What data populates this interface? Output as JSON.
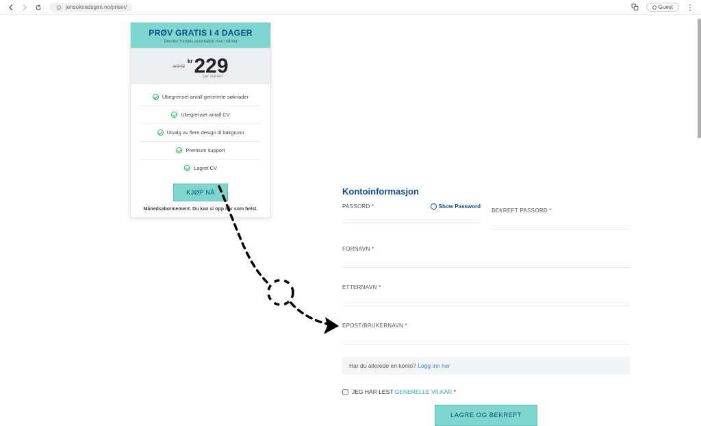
{
  "browser": {
    "url": "jensoknadsgen.no/priser/",
    "profile_label": "Guest"
  },
  "card": {
    "title": "PRØV GRATIS I 4 DAGER",
    "subtitle": "Deretter fornyes automatisk hver måned",
    "strike_price": "kr349",
    "currency": "kr",
    "price": "229",
    "per": "per måned",
    "features": [
      "Ubegrenset antall genererte søknader",
      "Ubegrenset antall CV",
      "Utvalg av flere design til bakgrunn",
      "Premium support",
      "Lagret CV"
    ],
    "buy_label": "KJØP NÅ",
    "footnote": "Månedsabonnement. Du kan si opp når som helst."
  },
  "form": {
    "title": "Kontoinformasjon",
    "password_label": "PASSORD *",
    "show_password": "Show Password",
    "confirm_label": "BEKREFT PASSORD *",
    "firstname_label": "FORNAVN *",
    "lastname_label": "ETTERNAVN *",
    "email_label": "EPOST/BRUKERNAVN *",
    "already_text": "Har du allerede en konto? ",
    "login_link": "Logg inn her",
    "terms_prefix": "JEG HAR LEST ",
    "terms_link": "GENERELLE VILKÅR",
    "terms_suffix": " *",
    "submit": "LAGRE OG BEKREFT"
  }
}
